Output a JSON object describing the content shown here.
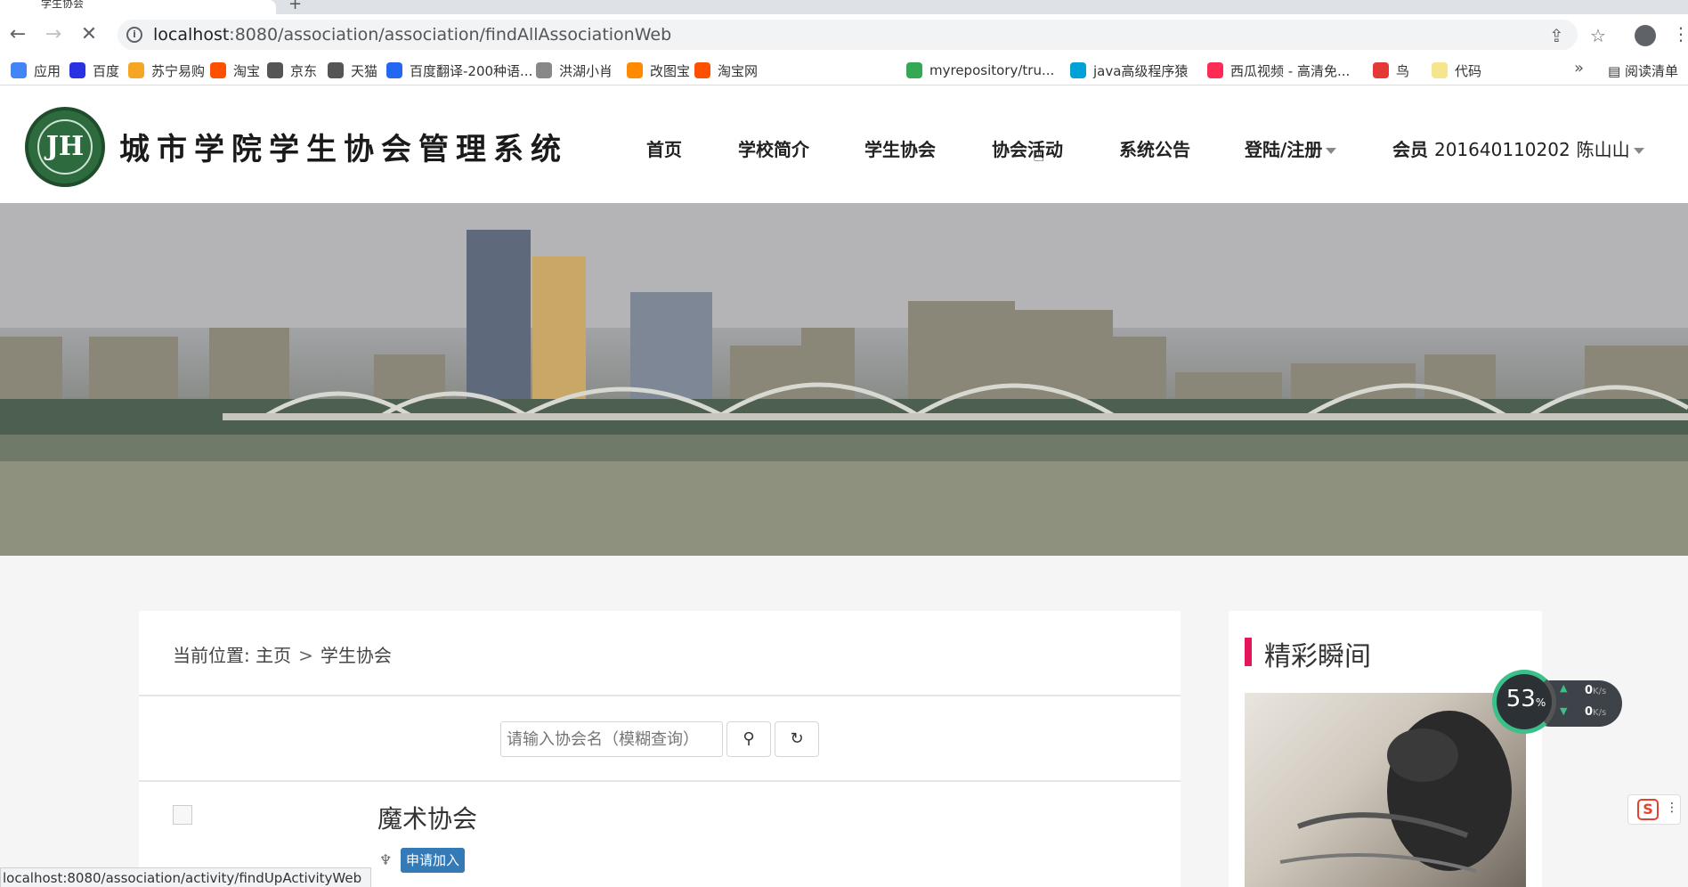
{
  "browser": {
    "tab_title": "学生协会",
    "url_host": "localhost",
    "url_path": ":8080/association/association/findAllAssociationWeb",
    "bookmarks": [
      {
        "label": "应用",
        "color": "#4285f4"
      },
      {
        "label": "百度",
        "color": "#2932e1"
      },
      {
        "label": "苏宁易购",
        "color": "#f5a623"
      },
      {
        "label": "淘宝",
        "color": "#ff5000"
      },
      {
        "label": "京东",
        "color": "#555555"
      },
      {
        "label": "天猫",
        "color": "#555555"
      },
      {
        "label": "百度翻译-200种语...",
        "color": "#2468f2"
      },
      {
        "label": "洪湖小肖",
        "color": "#888888"
      },
      {
        "label": "改图宝",
        "color": "#ff8a00"
      },
      {
        "label": "淘宝网",
        "color": "#ff5000"
      },
      {
        "label": "myrepository/tru...",
        "color": "#34a853"
      },
      {
        "label": "java高级程序猿",
        "color": "#00a1d6"
      },
      {
        "label": "西瓜视频 - 高清免...",
        "color": "#fe2c55"
      },
      {
        "label": "鸟",
        "color": "#e53935"
      },
      {
        "label": "代码",
        "color": "#f6e58d"
      }
    ],
    "bookmarks_more": "»",
    "reading_list": "阅读清单",
    "status_url": "localhost:8080/association/activity/findUpActivityWeb"
  },
  "site": {
    "title": "城市学院学生协会管理系统",
    "logo_text": "JH",
    "nav": {
      "home": "首页",
      "intro": "学校简介",
      "assoc": "学生协会",
      "activity": "协会活动",
      "notice": "系统公告",
      "login": "登陆/注册",
      "member_label": "会员",
      "member_id": "201640110202",
      "member_name": "陈山山"
    }
  },
  "main": {
    "breadcrumb_prefix": "当前位置:",
    "breadcrumb_home": "主页",
    "breadcrumb_sep": ">",
    "breadcrumb_current": "学生协会",
    "search_placeholder": "请输入协会名（模糊查询）",
    "association": {
      "name": "魔术协会",
      "join_label": "申请加入"
    }
  },
  "sidebar": {
    "title": "精彩瞬间"
  },
  "speed": {
    "percent": "53",
    "percent_unit": "%",
    "up": "0",
    "down": "0",
    "unit": "K/s"
  },
  "ime": {
    "label": "S",
    "dots": "⋮"
  },
  "colors": {
    "accent_pink": "#e4165a",
    "join_button": "#337ab7",
    "logo_green": "#2d6b3e"
  }
}
